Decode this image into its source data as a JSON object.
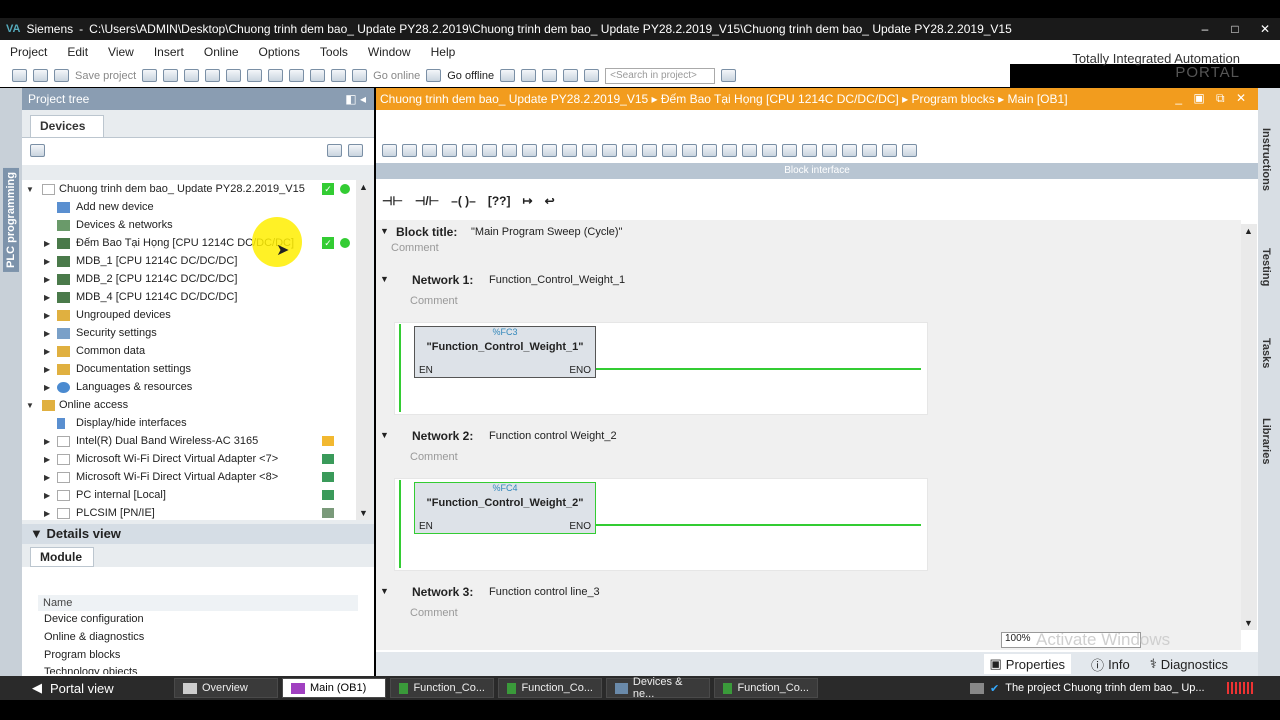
{
  "window": {
    "app": "Siemens",
    "path": "C:\\Users\\ADMIN\\Desktop\\Chuong trinh dem bao_ Update PY28.2.2019\\Chuong trinh dem bao_ Update PY28.2.2019_V15\\Chuong trinh dem bao_ Update PY28.2.2019_V15"
  },
  "menu": [
    "Project",
    "Edit",
    "View",
    "Insert",
    "Online",
    "Options",
    "Tools",
    "Window",
    "Help"
  ],
  "brand": {
    "line1": "Totally Integrated Automation",
    "line2": "PORTAL"
  },
  "toolbar": {
    "save_project": "Save project",
    "go_online": "Go online",
    "go_offline": "Go offline",
    "search_placeholder": "<Search in project>"
  },
  "project_tree": {
    "title": "Project tree",
    "tab": "Devices",
    "side_label": "PLC programming",
    "items": [
      {
        "label": "Chuong trinh dem bao_ Update PY28.2.2019_V15",
        "level": 0,
        "expanded": true,
        "status": "ok"
      },
      {
        "label": "Add new device",
        "level": 1
      },
      {
        "label": "Devices & networks",
        "level": 1
      },
      {
        "label": "Đếm Bao Tại Họng [CPU 1214C DC/DC/DC]",
        "level": 1,
        "collapsed": true,
        "status": "ok"
      },
      {
        "label": "MDB_1 [CPU 1214C DC/DC/DC]",
        "level": 1,
        "collapsed": true
      },
      {
        "label": "MDB_2 [CPU 1214C DC/DC/DC]",
        "level": 1,
        "collapsed": true
      },
      {
        "label": "MDB_4 [CPU 1214C DC/DC/DC]",
        "level": 1,
        "collapsed": true
      },
      {
        "label": "Ungrouped devices",
        "level": 1,
        "collapsed": true
      },
      {
        "label": "Security settings",
        "level": 1,
        "collapsed": true
      },
      {
        "label": "Common data",
        "level": 1,
        "collapsed": true
      },
      {
        "label": "Documentation settings",
        "level": 1,
        "collapsed": true
      },
      {
        "label": "Languages & resources",
        "level": 1,
        "collapsed": true
      },
      {
        "label": "Online access",
        "level": 0,
        "expanded": true
      },
      {
        "label": "Display/hide interfaces",
        "level": 1
      },
      {
        "label": "Intel(R) Dual Band Wireless-AC 3165",
        "level": 1,
        "collapsed": true
      },
      {
        "label": "Microsoft Wi-Fi Direct Virtual Adapter <7>",
        "level": 1,
        "collapsed": true
      },
      {
        "label": "Microsoft Wi-Fi Direct Virtual Adapter <8>",
        "level": 1,
        "collapsed": true
      },
      {
        "label": "PC internal [Local]",
        "level": 1,
        "collapsed": true
      },
      {
        "label": "PLCSIM [PN/IE]",
        "level": 1,
        "collapsed": true
      }
    ]
  },
  "details": {
    "title": "Details view",
    "tab": "Module",
    "column": "Name",
    "rows": [
      "Device configuration",
      "Online & diagnostics",
      "Program blocks",
      "Technology objects"
    ]
  },
  "editor": {
    "breadcrumb": "Chuong trinh dem bao_ Update PY28.2.2019_V15  ▸  Đếm Bao Tại Họng [CPU 1214C DC/DC/DC]  ▸  Program blocks  ▸  Main [OB1]",
    "block_interface": "Block interface",
    "block_title_label": "Block title:",
    "block_title_value": "\"Main Program Sweep (Cycle)\"",
    "comment": "Comment",
    "networks": [
      {
        "label": "Network 1:",
        "title": "Function_Control_Weight_1",
        "fc_tag": "%FC3",
        "fc_name": "\"Function_Control_Weight_1\"",
        "en": "EN",
        "eno": "ENO"
      },
      {
        "label": "Network 2:",
        "title": "Function control Weight_2",
        "fc_tag": "%FC4",
        "fc_name": "\"Function_Control_Weight_2\"",
        "en": "EN",
        "eno": "ENO"
      },
      {
        "label": "Network 3:",
        "title": "Function control line_3"
      }
    ],
    "zoom": "100%",
    "watermark": "Activate Windows"
  },
  "right_tabs": [
    "Instructions",
    "Testing",
    "Tasks",
    "Libraries"
  ],
  "inspector": {
    "properties": "Properties",
    "info": "Info",
    "diagnostics": "Diagnostics"
  },
  "taskbar": {
    "portal_view": "Portal view",
    "items": [
      "Overview",
      "Main (OB1)",
      "Function_Co...",
      "Function_Co...",
      "Devices & ne...",
      "Function_Co..."
    ],
    "status": "The project Chuong trinh dem bao_ Up..."
  },
  "colors": {
    "accent": "#f29c1e",
    "panel": "#8a9db2",
    "ok": "#33cc33"
  }
}
